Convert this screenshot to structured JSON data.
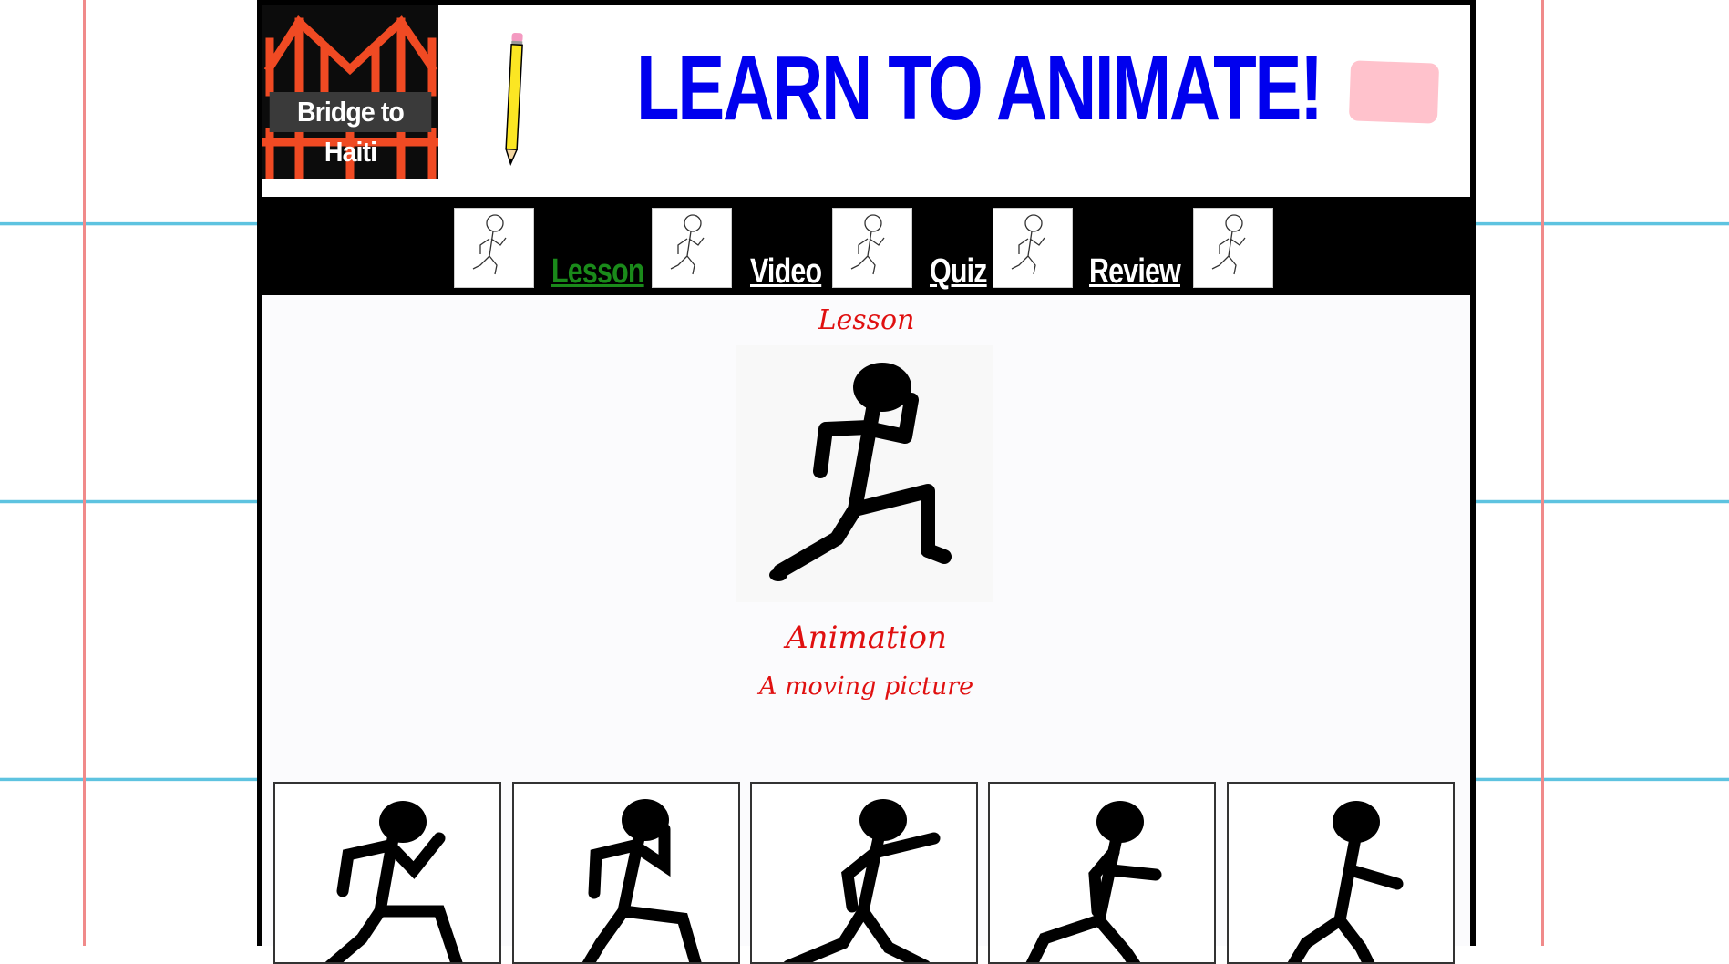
{
  "header": {
    "logo_text": "Bridge to Haiti",
    "title": "LEARN TO ANIMATE!"
  },
  "nav": {
    "items": [
      {
        "label": "Lesson",
        "active": true
      },
      {
        "label": "Video",
        "active": false
      },
      {
        "label": "Quiz",
        "active": false
      },
      {
        "label": "Review",
        "active": false
      }
    ]
  },
  "main": {
    "section_title": "Lesson",
    "term": "Animation",
    "definition": "A moving picture",
    "frame_count": 5
  },
  "colors": {
    "title": "#0000ee",
    "active_nav": "#1a8a1a",
    "lesson_text": "#e01010",
    "eraser": "#ffc2cc",
    "ruled_line": "#62c4e1",
    "margin_line": "#f08a8a"
  }
}
